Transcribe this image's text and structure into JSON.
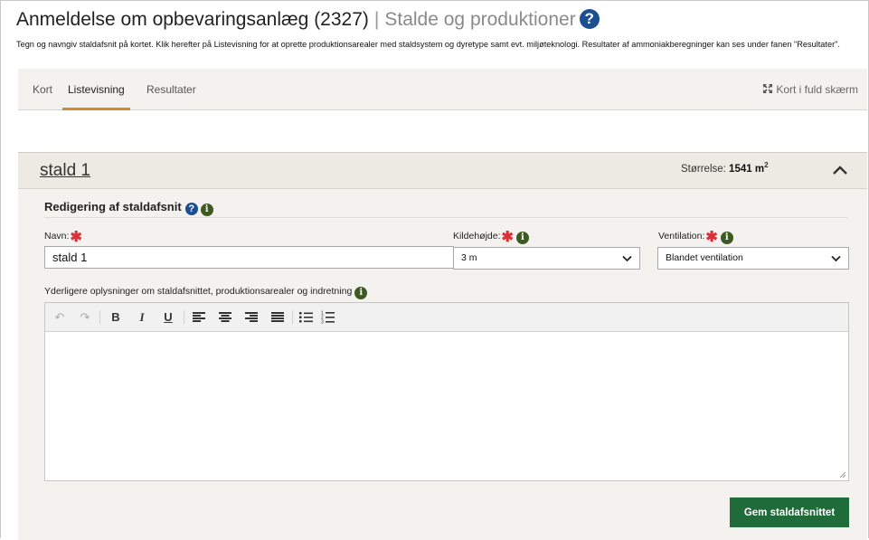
{
  "header": {
    "title": "Anmeldelse om opbevaringsanlæg (2327)",
    "separator": "|",
    "subtitle": "Stalde og produktioner",
    "help_icon": "question-circle-icon"
  },
  "description": "Tegn og navngiv staldafsnit på kortet. Klik herefter på Listevisning for at oprette produktionsarealer med staldsystem og dyretype samt evt. miljøteknologi. Resultater af ammoniakberegninger kan ses under fanen \"Resultater\".",
  "tabs": [
    {
      "label": "Kort"
    },
    {
      "label": "Listevisning"
    },
    {
      "label": "Resultater"
    }
  ],
  "fullscreen_label": "Kort i fuld skærm",
  "panel": {
    "title": "stald 1",
    "size_label": "Størrelse:",
    "size_value": "1541 m",
    "size_unit_sup": "2",
    "section_title": "Redigering af staldafsnit",
    "fields": {
      "name_label": "Navn:",
      "name_value": "stald 1",
      "height_label": "Kildehøjde:",
      "height_value": "3 m",
      "ventilation_label": "Ventilation:",
      "ventilation_value": "Blandet ventilation"
    },
    "extra_label": "Yderligere oplysninger om staldafsnittet, produktionsarealer og indretning",
    "toolbar": {
      "undo": "↶",
      "redo": "↷",
      "bold": "B",
      "italic": "I",
      "underline": "U"
    },
    "save_label": "Gem staldafsnittet"
  },
  "colors": {
    "accent_tab": "#d68a2e",
    "save_button": "#1f6b3a",
    "help_icon": "#1b4f8f",
    "info_icon": "#3c5a22",
    "required": "#d9303a"
  }
}
